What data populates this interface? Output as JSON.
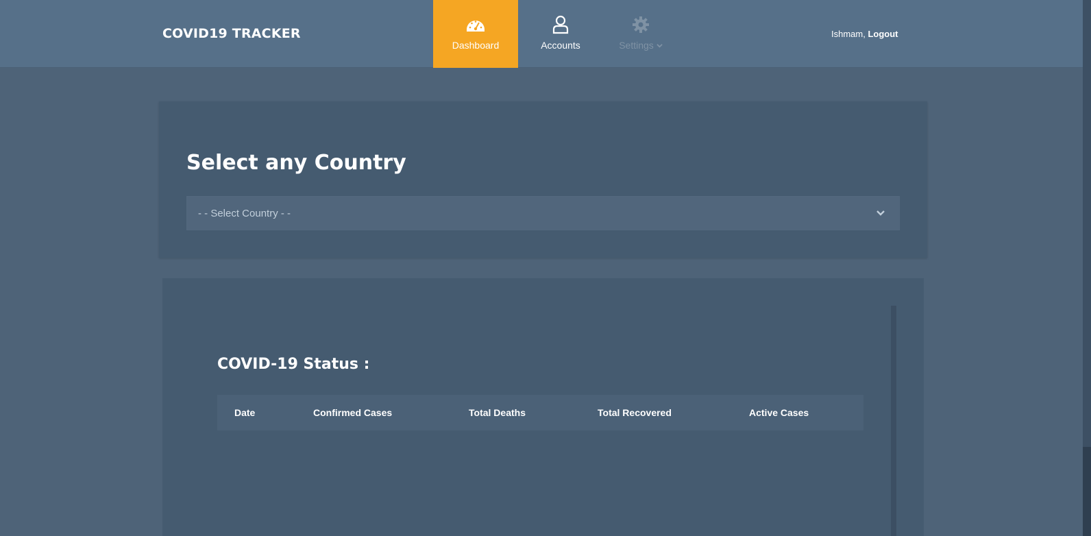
{
  "header": {
    "brand": "COVID19 TRACKER",
    "nav": [
      {
        "label": "Dashboard",
        "icon": "dashboard-gauge-icon",
        "active": true
      },
      {
        "label": "Accounts",
        "icon": "user-icon",
        "active": false
      },
      {
        "label": "Settings",
        "icon": "gear-icon",
        "active": false,
        "disabled": true
      }
    ],
    "user_name": "Ishmam,",
    "logout_label": "Logout"
  },
  "country_card": {
    "title": "Select any Country",
    "select_placeholder": "- - Select Country - -"
  },
  "status_card": {
    "title": "COVID-19 Status :",
    "columns": [
      "Date",
      "Confirmed Cases",
      "Total Deaths",
      "Total Recovered",
      "Active Cases"
    ],
    "rows": []
  },
  "colors": {
    "background": "#4e6378",
    "header": "#567089",
    "accent": "#f5a623",
    "card": "#455b70"
  }
}
